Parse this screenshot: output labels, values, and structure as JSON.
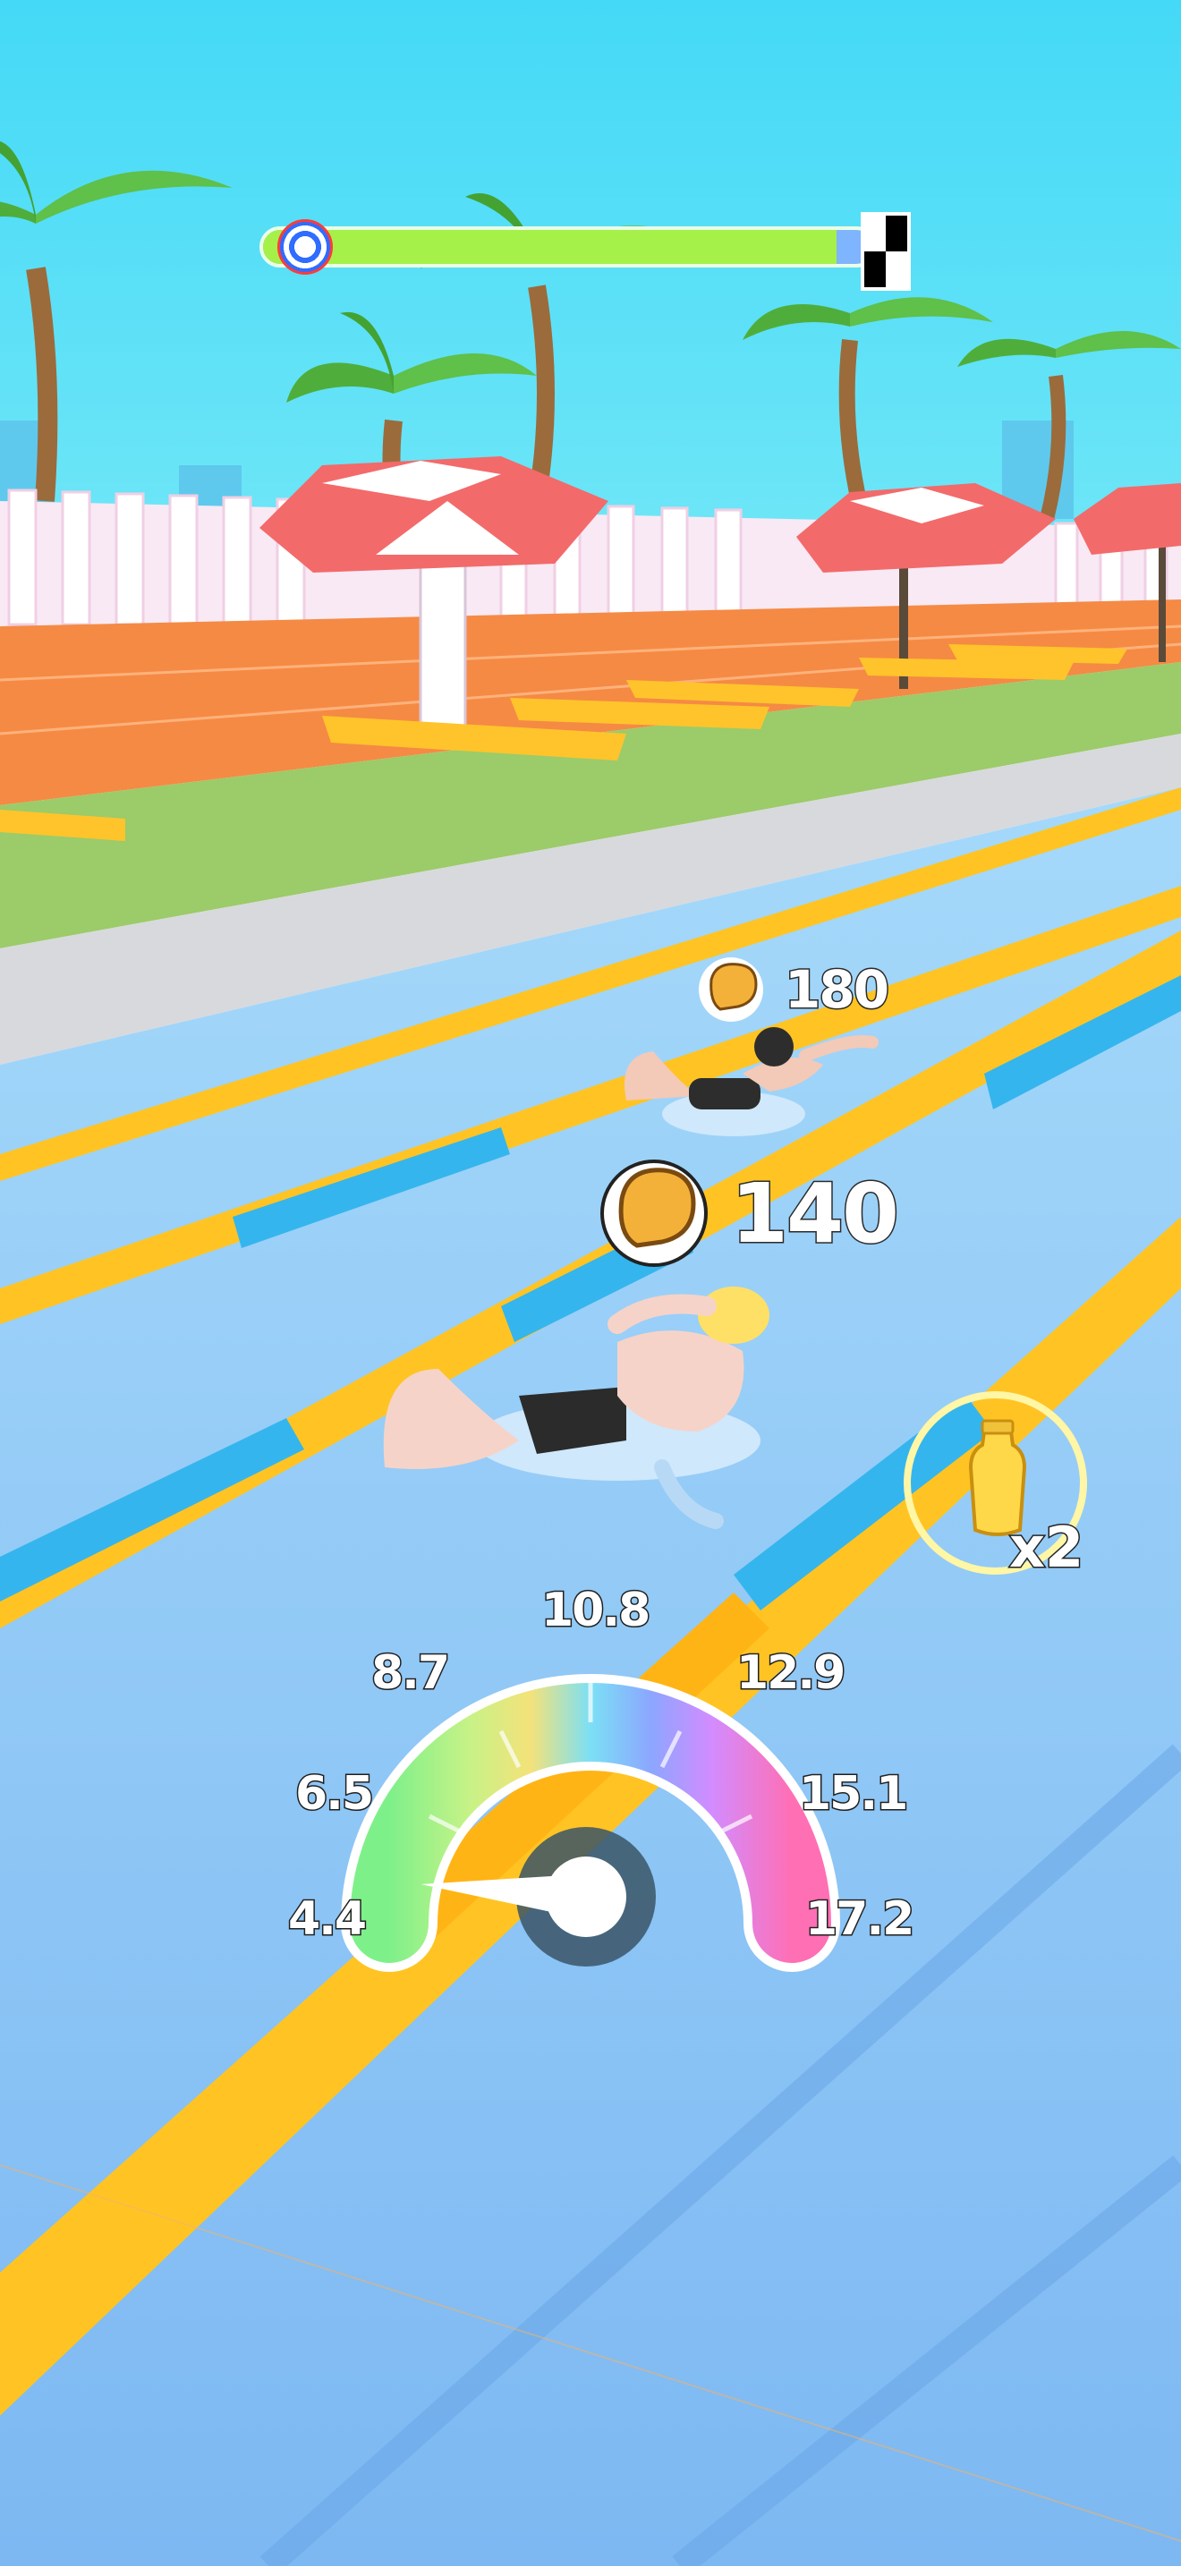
{
  "race_progress": {
    "fraction": 0.94
  },
  "opponent": {
    "power": "180"
  },
  "player": {
    "power": "140"
  },
  "powerup": {
    "icon": "water-bottle-icon",
    "multiplier": "x2"
  },
  "speedometer": {
    "ticks": [
      "4.4",
      "6.5",
      "8.7",
      "10.8",
      "12.9",
      "15.1",
      "17.2"
    ],
    "needle_value": 4.7
  },
  "colors": {
    "sky": "#49dcf5",
    "water": "#7ec1f6",
    "lane_yellow": "#ffc423",
    "lane_blue": "#35b5ee",
    "progress_fill": "#a6f04a"
  }
}
